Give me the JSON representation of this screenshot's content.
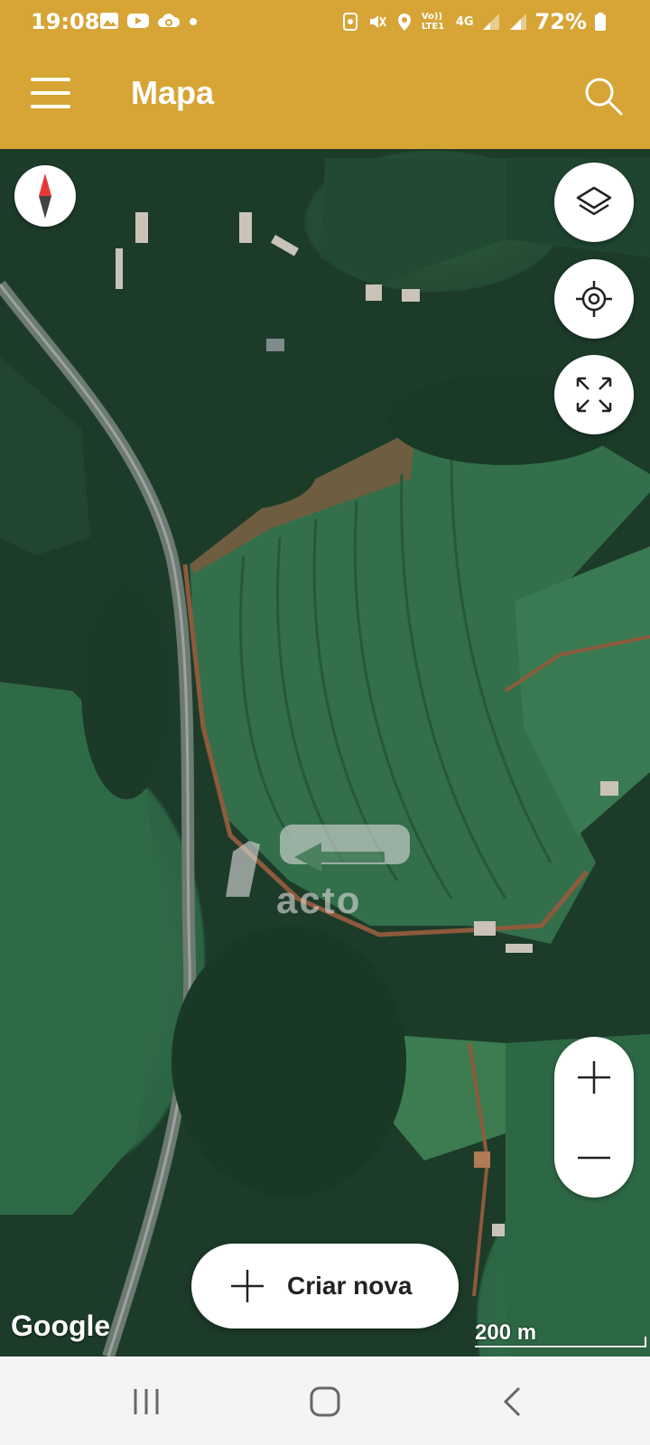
{
  "status_bar": {
    "time": "19:08",
    "battery": "72%",
    "icons_left": [
      "gallery-icon",
      "youtube-icon",
      "cloud-sync-icon",
      "dot-icon"
    ],
    "icons_right": [
      "screenshot-icon",
      "mute-icon",
      "location-icon",
      "volte-icon",
      "4g-icon",
      "signal-icon",
      "signal-icon",
      "battery-icon"
    ],
    "volte_label": "Vo)) LTE1",
    "net_label": "4G"
  },
  "app_bar": {
    "title": "Mapa",
    "menu_icon": "menu-icon",
    "search_icon": "search-icon",
    "color": "#d6a536"
  },
  "map": {
    "compass_icon": "compass-icon",
    "layers_icon": "layers-icon",
    "locate_icon": "my-location-icon",
    "fullscreen_icon": "expand-icon",
    "zoom_in_icon": "plus-icon",
    "zoom_out_icon": "minus-icon",
    "attribution": "Google",
    "scale_label": "200 m",
    "watermark_text": "acto"
  },
  "actions": {
    "create_label": "Criar nova",
    "create_icon": "plus-icon"
  },
  "nav_bar": {
    "recent_icon": "recent-apps-icon",
    "home_icon": "home-icon",
    "back_icon": "back-icon"
  }
}
